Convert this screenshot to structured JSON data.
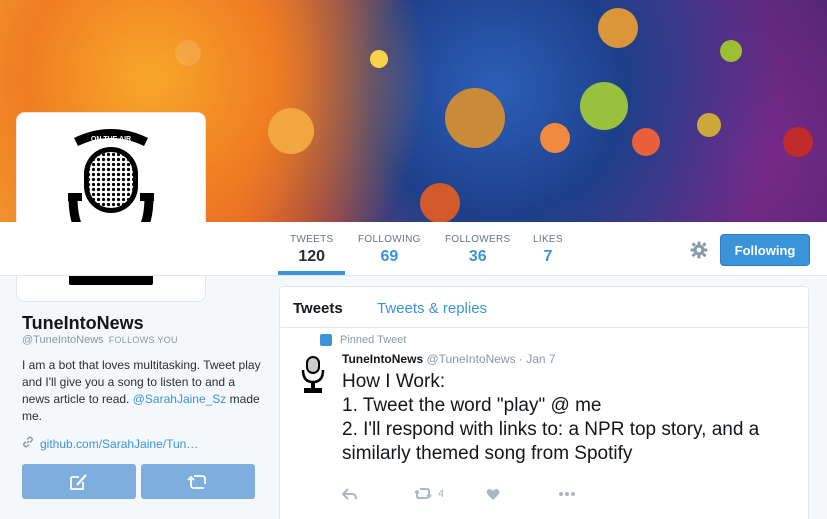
{
  "profile": {
    "name": "TuneIntoNews",
    "handle": "@TuneIntoNews",
    "follows_you": "FOLLOWS YOU",
    "bio_text": "I am a bot that loves multitasking. Tweet play and I'll give you a song to listen to and a news article to read.",
    "bio_mention": "@SarahJaine_Sz",
    "bio_suffix": " made me.",
    "link": "github.com/SarahJaine/Tun…",
    "avatar_badge": "ON THE AIR"
  },
  "stats": [
    {
      "label": "TWEETS",
      "value": "120"
    },
    {
      "label": "FOLLOWING",
      "value": "69"
    },
    {
      "label": "FOLLOWERS",
      "value": "36"
    },
    {
      "label": "LIKES",
      "value": "7"
    }
  ],
  "follow_button": "Following",
  "timeline": {
    "tabs": [
      "Tweets",
      "Tweets & replies"
    ],
    "pinned_label": "Pinned Tweet",
    "tweet": {
      "name": "TuneIntoNews",
      "handle": "@TuneIntoNews",
      "date": "· Jan 7",
      "lines": [
        "How I Work:",
        "1. Tweet the word \"play\" @ me",
        "2. I'll respond with links to: a NPR top story, and a similarly themed song from Spotify"
      ],
      "retweet_count": "4"
    }
  },
  "icons": {
    "settings": "gear-icon",
    "reply": "reply-icon",
    "retweet": "retweet-icon",
    "like": "heart-icon",
    "more": "more-icon",
    "link": "link-icon",
    "compose": "compose-icon",
    "retweet_btn": "retweet-action-icon",
    "pin": "pin-icon"
  },
  "colors": {
    "accent": "#3b94d9",
    "muted": "#8899a6"
  }
}
